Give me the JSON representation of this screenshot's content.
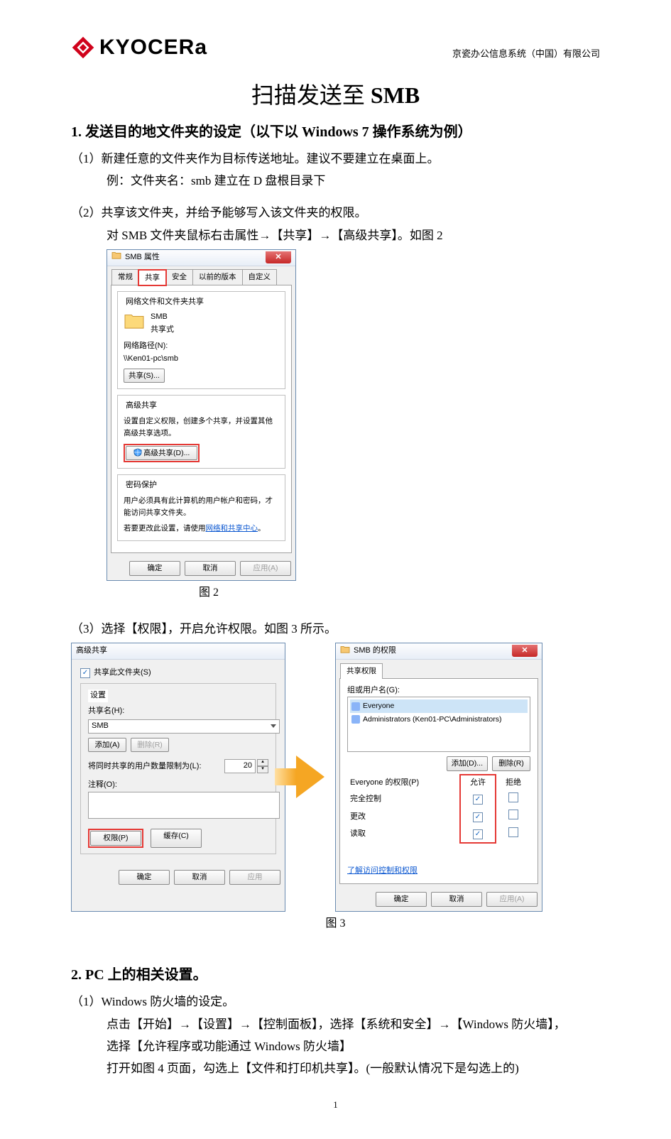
{
  "header": {
    "brand": "KYOCERa",
    "company": "京瓷办公信息系统（中国）有限公司"
  },
  "title": {
    "pre": "扫描发送至 ",
    "latin": "SMB"
  },
  "sec1": {
    "heading_num": "1.",
    "heading_text_1": " 发送目的地文件夹的设定（以下以 ",
    "heading_latin": "Windows  7 ",
    "heading_text_2": "操作系统为例）",
    "p1a": "（1）新建任意的文件夹作为目标传送地址。建议不要建立在桌面上。",
    "p1b": "例：文件夹名：smb  建立在 D 盘根目录下",
    "p2a": "（2）共享该文件夹，并给予能够写入该文件夹的权限。",
    "p2b": "对 SMB 文件夹鼠标右击属性→【共享】→【高级共享】。如图 2",
    "p3": "（3）选择【权限】，开启允许权限。如图 3 所示。",
    "fig2_caption": "图 2",
    "fig3_caption": "图 3"
  },
  "fig2": {
    "title": "SMB 属性",
    "tabs": [
      "常规",
      "共享",
      "安全",
      "以前的版本",
      "自定义"
    ],
    "group1_title": "网络文件和文件夹共享",
    "folder_name": "SMB",
    "shared_state": "共享式",
    "net_path_label": "网络路径(N):",
    "net_path": "\\\\Ken01-pc\\smb",
    "share_btn": "共享(S)...",
    "group2_title": "高级共享",
    "adv_desc": "设置自定义权限，创建多个共享，并设置其他高级共享选项。",
    "adv_btn": "高级共享(D)...",
    "group3_title": "密码保护",
    "pwd_desc": "用户必须具有此计算机的用户帐户和密码，才能访问共享文件夹。",
    "pwd_link_pre": "若要更改此设置，请使用",
    "pwd_link": "网络和共享中心",
    "ok": "确定",
    "cancel": "取消",
    "apply": "应用(A)"
  },
  "fig3a": {
    "title": "高级共享",
    "chk_label": "共享此文件夹(S)",
    "settings_label": "设置",
    "share_name_label": "共享名(H):",
    "share_name_value": "SMB",
    "add_btn": "添加(A)",
    "del_btn": "删除(R)",
    "limit_label": "将同时共享的用户数量限制为(L):",
    "limit_value": "20",
    "comment_label": "注释(O):",
    "perm_btn": "权限(P)",
    "cache_btn": "缓存(C)",
    "ok": "确定",
    "cancel": "取消",
    "apply": "应用"
  },
  "fig3b": {
    "title": "SMB 的权限",
    "tab": "共享权限",
    "groups_label": "组或用户名(G):",
    "users": [
      {
        "name": "Everyone",
        "sel": true
      },
      {
        "name": "Administrators (Ken01-PC\\Administrators)",
        "sel": false
      }
    ],
    "add_btn": "添加(D)...",
    "del_btn": "删除(R)",
    "perm_for": "Everyone 的权限(P)",
    "col_allow": "允许",
    "col_deny": "拒绝",
    "rows": [
      {
        "label": "完全控制",
        "allow": true,
        "deny": false
      },
      {
        "label": "更改",
        "allow": true,
        "deny": false
      },
      {
        "label": "读取",
        "allow": true,
        "deny": false
      }
    ],
    "learn_link": "了解访问控制和权限",
    "ok": "确定",
    "cancel": "取消",
    "apply": "应用(A)"
  },
  "sec2": {
    "heading_num": "2.",
    "heading_latin": " PC ",
    "heading_text": "上的相关设置。",
    "p1": "（1）Windows 防火墙的设定。",
    "p2": "点击【开始】→【设置】→【控制面板】，选择【系统和安全】→【Windows 防火墙】，",
    "p3": "选择【允许程序或功能通过 Windows 防火墙】",
    "p4": "打开如图 4 页面，勾选上【文件和打印机共享】。(一般默认情况下是勾选上的)"
  },
  "page_number": "1"
}
